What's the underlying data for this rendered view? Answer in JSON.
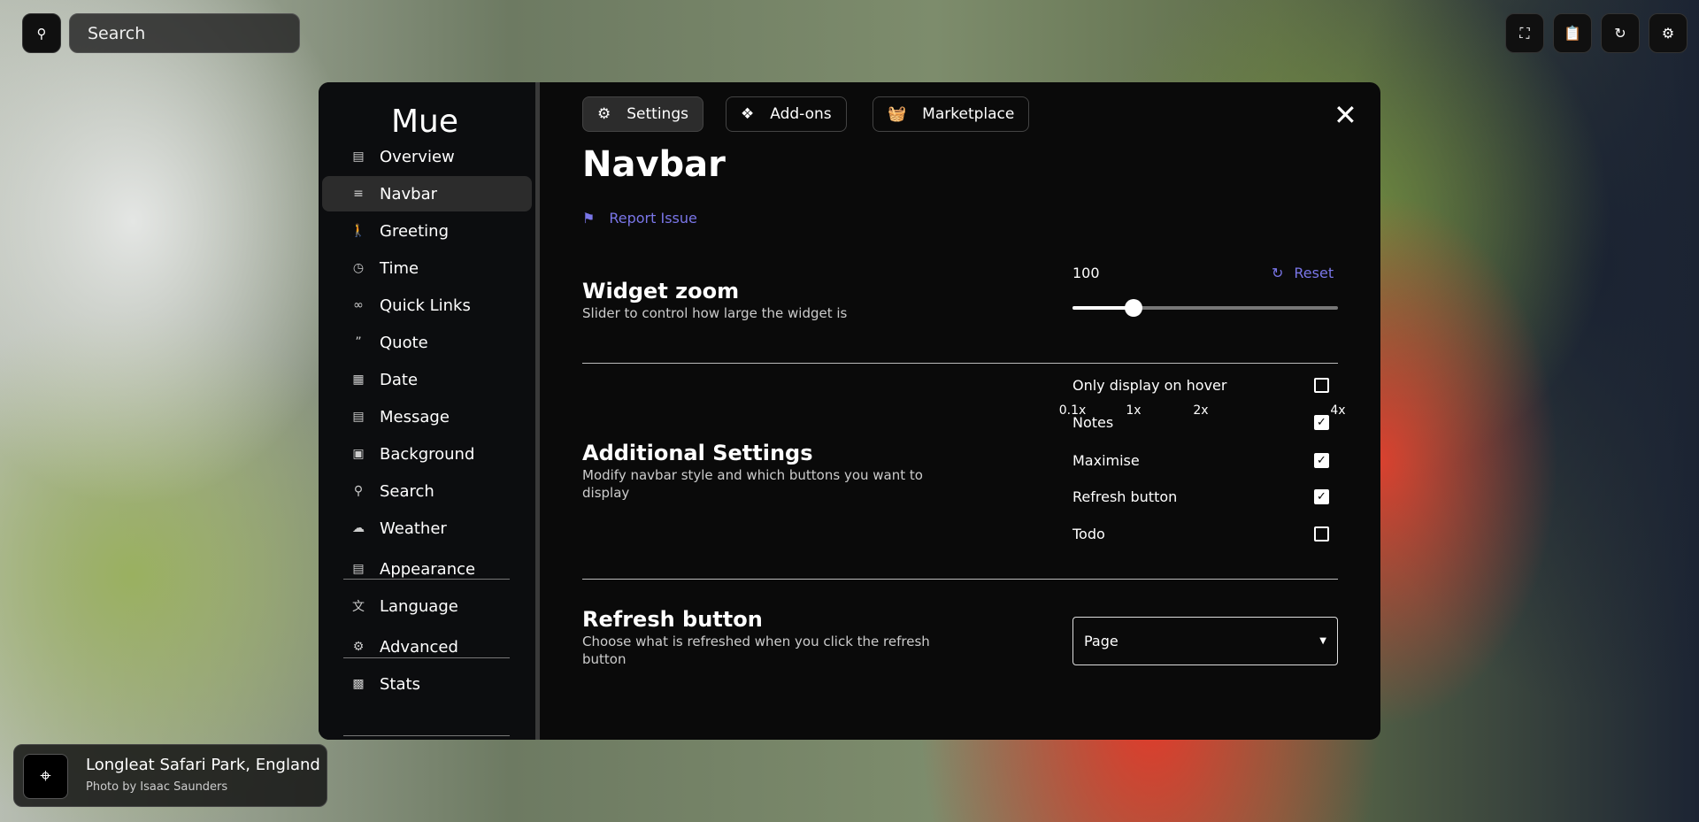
{
  "topbar": {
    "search_placeholder": "Search",
    "icons": [
      "fullscreen-icon",
      "clipboard-icon",
      "refresh-icon",
      "gear-icon"
    ]
  },
  "modal": {
    "logo": "Mue",
    "sidebar": [
      {
        "label": "Overview",
        "icon": "overview-icon"
      },
      {
        "label": "Navbar",
        "icon": "menu-icon",
        "active": true
      },
      {
        "label": "Greeting",
        "icon": "waving-person-icon"
      },
      {
        "label": "Time",
        "icon": "alarm-icon"
      },
      {
        "label": "Quick Links",
        "icon": "link-icon"
      },
      {
        "label": "Quote",
        "icon": "quote-icon"
      },
      {
        "label": "Date",
        "icon": "calendar-icon"
      },
      {
        "label": "Message",
        "icon": "message-icon"
      },
      {
        "label": "Background",
        "icon": "image-icon"
      },
      {
        "label": "Search",
        "icon": "search-icon"
      },
      {
        "label": "Weather",
        "icon": "cloud-icon"
      },
      {
        "label": "Appearance",
        "icon": "paint-roller-icon"
      },
      {
        "label": "Language",
        "icon": "translate-icon"
      },
      {
        "label": "Advanced",
        "icon": "gear-icon"
      },
      {
        "label": "Stats",
        "icon": "chart-icon"
      }
    ],
    "tabs": [
      {
        "label": "Settings",
        "active": true
      },
      {
        "label": "Add-ons"
      },
      {
        "label": "Marketplace"
      }
    ],
    "title": "Navbar",
    "report_issue": "Report Issue",
    "widget_zoom": {
      "title": "Widget zoom",
      "description": "Slider to control how large the widget is",
      "value": "100",
      "reset": "Reset",
      "slider": {
        "min": 0.1,
        "max": 4,
        "value": 1
      },
      "ticks": [
        "0.1x",
        "1x",
        "2x",
        "4x"
      ]
    },
    "additional": {
      "title": "Additional Settings",
      "description": "Modify navbar style and which buttons you want to display",
      "options": [
        {
          "label": "Only display on hover",
          "checked": false
        },
        {
          "label": "Notes",
          "checked": true
        },
        {
          "label": "Maximise",
          "checked": true
        },
        {
          "label": "Refresh button",
          "checked": true
        },
        {
          "label": "Todo",
          "checked": false
        }
      ]
    },
    "refresh": {
      "title": "Refresh button",
      "description": "Choose what is refreshed when you click the refresh button",
      "selected": "Page"
    }
  },
  "photo": {
    "location": "Longleat Safari Park, England",
    "credit": "Photo by Isaac Saunders"
  },
  "colors": {
    "accent": "#7a76e8",
    "modal_bg": "#0a0a0a"
  }
}
